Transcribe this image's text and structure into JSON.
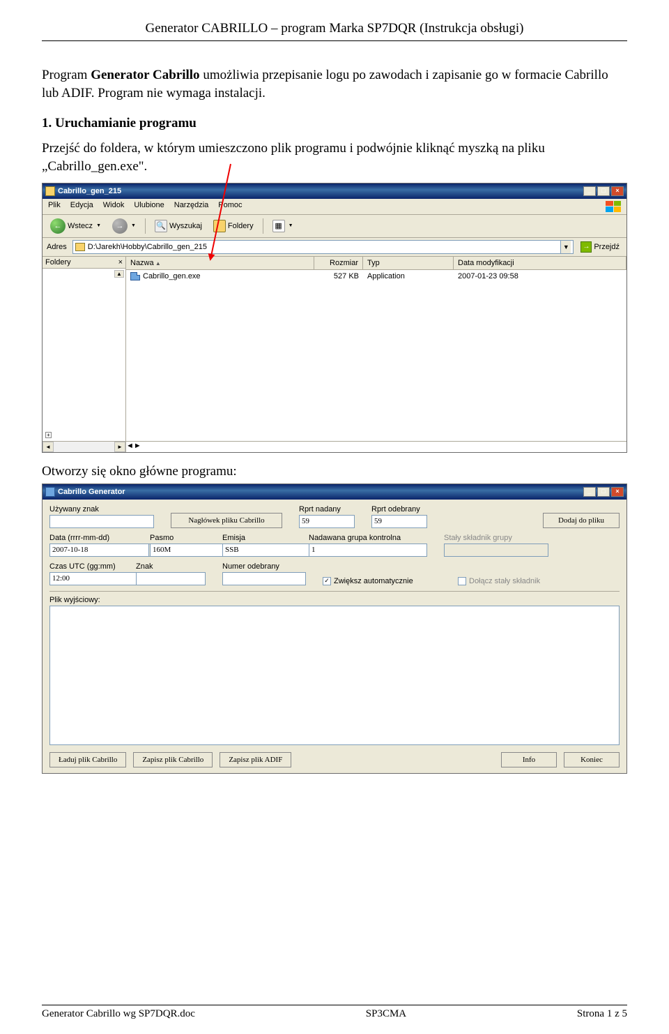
{
  "header": {
    "title": "Generator CABRILLO – program Marka SP7DQR (Instrukcja obsługi)"
  },
  "intro": {
    "prefix": "Program ",
    "bold": "Generator Cabrillo",
    "rest": " umożliwia przepisanie logu po zawodach i zapisanie go w formacie Cabrillo lub ADIF. Program nie wymaga instalacji."
  },
  "section1": {
    "heading": "1. Uruchamianie programu",
    "text": "Przejść do foldera, w którym umieszczono plik programu i podwójnie kliknąć myszką na pliku „Cabrillo_gen.exe\"."
  },
  "explorer": {
    "title": "Cabrillo_gen_215",
    "menu": {
      "plik": "Plik",
      "edycja": "Edycja",
      "widok": "Widok",
      "ulubione": "Ulubione",
      "narzedzia": "Narzędzia",
      "pomoc": "Pomoc"
    },
    "toolbar": {
      "back": "Wstecz",
      "search": "Wyszukaj",
      "folders": "Foldery"
    },
    "address": {
      "label": "Adres",
      "value": "D:\\Jarekh\\Hobby\\Cabrillo_gen_215",
      "go": "Przejdź"
    },
    "tree": {
      "label": "Foldery",
      "close": "×"
    },
    "columns": {
      "name": "Nazwa",
      "size": "Rozmiar",
      "type": "Typ",
      "date": "Data modyfikacji"
    },
    "row": {
      "name": "Cabrillo_gen.exe",
      "size": "527 KB",
      "type": "Application",
      "date": "2007-01-23 09:58"
    }
  },
  "after1": "Otworzy się okno główne programu:",
  "cab": {
    "title": "Cabrillo Generator",
    "labels": {
      "uzywany": "Używany znak",
      "naglowek_btn": "Nagłówek pliku Cabrillo",
      "rprt_nad": "Rprt nadany",
      "rprt_odb": "Rprt odebrany",
      "dodaj_btn": "Dodaj do pliku",
      "data": "Data (rrrr-mm-dd)",
      "pasmo": "Pasmo",
      "emisja": "Emisja",
      "ngk": "Nadawana grupa kontrolna",
      "ssg": "Stały składnik grupy",
      "czas": "Czas UTC (gg:mm)",
      "znak": "Znak",
      "numer": "Numer odebrany",
      "zwieksz": "Zwiększ automatycznie",
      "dolacz": "Dołącz stały składnik",
      "plikwy": "Plik wyjściowy:"
    },
    "values": {
      "rprt_nad": "59",
      "rprt_odb": "59",
      "data": "2007-10-18",
      "pasmo": "160M",
      "emisja": "SSB",
      "ngk": "1",
      "czas": "12:00",
      "zwieksz_checked": "✓",
      "dolacz_checked": ""
    },
    "buttons": {
      "laduj": "Ładuj plik Cabrillo",
      "zapisz_cbr": "Zapisz plik Cabrillo",
      "zapisz_adif": "Zapisz plik ADIF",
      "info": "Info",
      "koniec": "Koniec"
    }
  },
  "footer": {
    "left": "Generator Cabrillo wg SP7DQR.doc",
    "center": "SP3CMA",
    "right": "Strona 1 z 5"
  }
}
